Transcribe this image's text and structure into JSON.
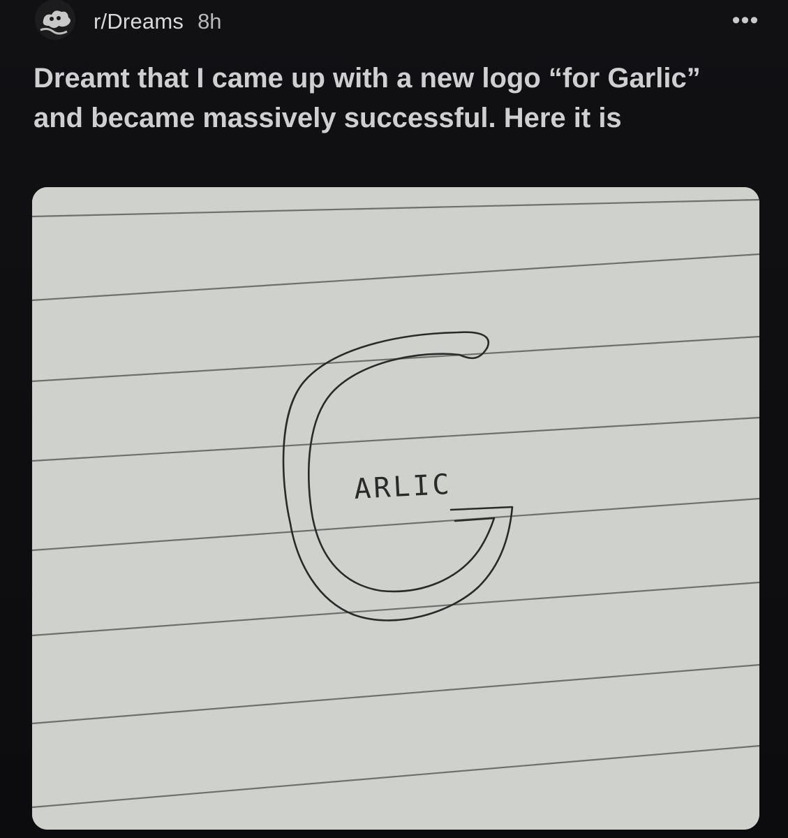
{
  "post": {
    "subreddit": "r/Dreams",
    "age": "8h",
    "title": "Dreamt that I came up with a new logo “for Garlic” and became massively successful. Here it is",
    "more_label": "•••"
  },
  "image": {
    "logo_text": "ARLIC",
    "paper_color": "#cfd1cd",
    "line_color": "#6f706e",
    "ink_color": "#2a2a2a"
  }
}
